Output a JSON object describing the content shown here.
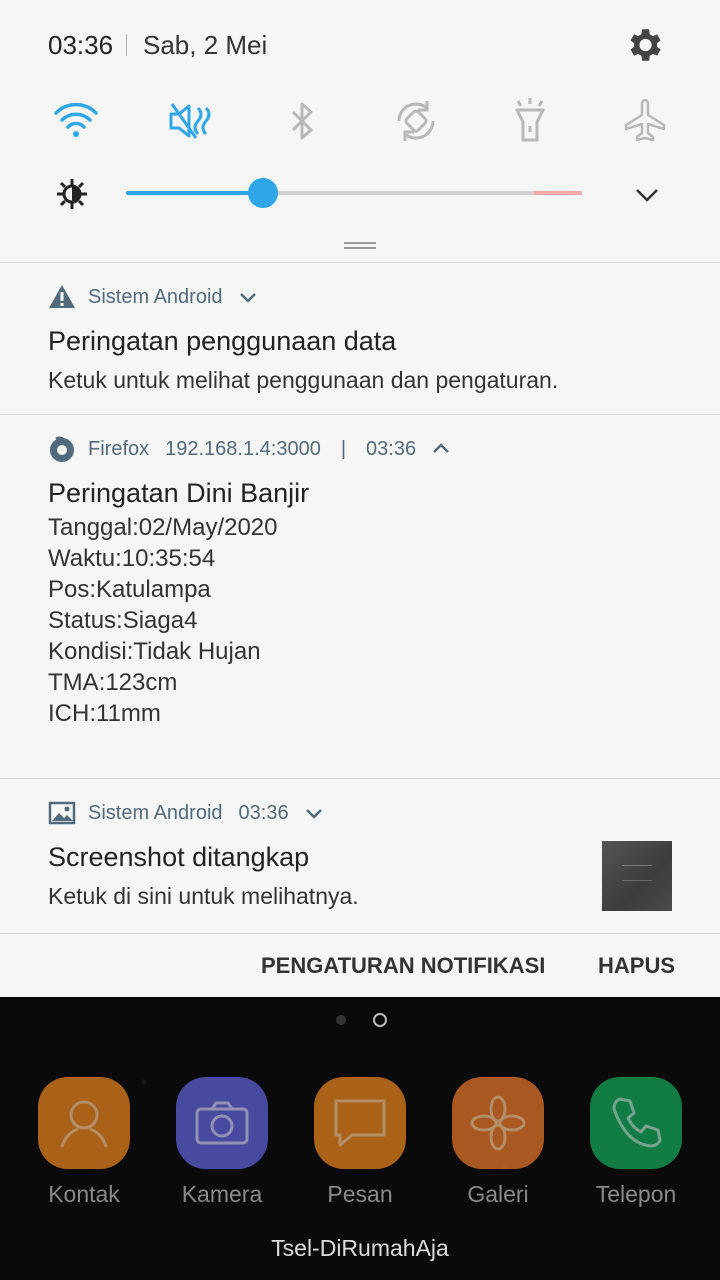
{
  "status": {
    "time": "03:36",
    "date": "Sab, 2 Mei"
  },
  "quick_settings": [
    {
      "name": "wifi-icon",
      "active": true
    },
    {
      "name": "sound-off-icon",
      "active": true
    },
    {
      "name": "bluetooth-icon",
      "active": false
    },
    {
      "name": "rotate-icon",
      "active": false
    },
    {
      "name": "flashlight-icon",
      "active": false
    },
    {
      "name": "airplane-icon",
      "active": false
    }
  ],
  "brightness": {
    "level": 0.3
  },
  "colors": {
    "accent": "#2ea6e8",
    "header_text": "#516a7c",
    "panel_bg": "#f6f6f6"
  },
  "notifications": [
    {
      "app": "Sistem Android",
      "title": "Peringatan penggunaan data",
      "text": "Ketuk untuk melihat penggunaan dan pengaturan."
    },
    {
      "app": "Firefox",
      "source": "192.168.1.4:3000",
      "separator": "|",
      "time": "03:36",
      "title": "Peringatan Dini Banjir",
      "lines": [
        "Tanggal:02/May/2020",
        "Waktu:10:35:54",
        "Pos:Katulampa",
        "Status:Siaga4",
        "Kondisi:Tidak Hujan",
        "TMA:123cm",
        "ICH:11mm"
      ]
    },
    {
      "app": "Sistem Android",
      "time": "03:36",
      "title": "Screenshot ditangkap",
      "text": "Ketuk di sini untuk melihatnya."
    }
  ],
  "actions": {
    "settings": "PENGATURAN NOTIFIKASI",
    "clear": "HAPUS"
  },
  "dock": [
    {
      "label": "Kontak",
      "color": "#e8841e",
      "icon": "contact-icon"
    },
    {
      "label": "Kamera",
      "color": "#5f63d8",
      "icon": "camera-icon"
    },
    {
      "label": "Pesan",
      "color": "#e8841e",
      "icon": "message-icon"
    },
    {
      "label": "Galeri",
      "color": "#e7772a",
      "icon": "gallery-icon"
    },
    {
      "label": "Telepon",
      "color": "#13a85a",
      "icon": "phone-icon"
    }
  ],
  "carrier": "Tsel-DiRumahAja"
}
